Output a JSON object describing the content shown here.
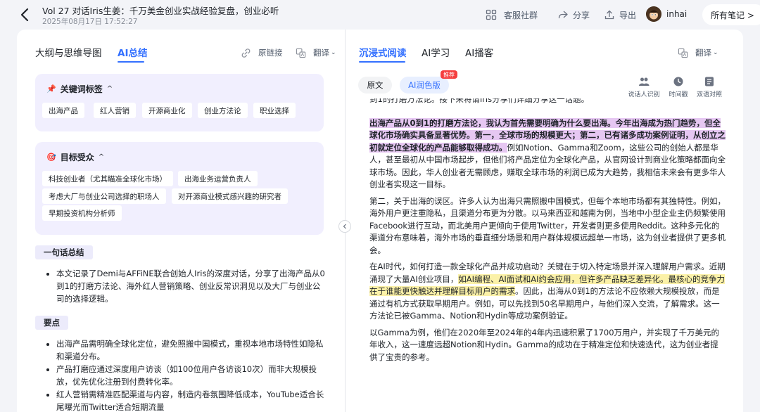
{
  "header": {
    "title": "Vol 27 对话Iris生姜：千万美金创业实战经验复盘，创业必听",
    "date": "2025年08月17日 17:52:27",
    "actions": {
      "service": "客服社群",
      "share": "分享",
      "export": "导出"
    },
    "user": "inhai",
    "all_notes": "所有笔记 >"
  },
  "left": {
    "tabs": [
      "大纲与思维导图",
      "AI总结"
    ],
    "actions": {
      "link": "原链接",
      "translate": "翻译"
    },
    "keywords": {
      "emoji": "📌",
      "title": "关键词标签",
      "chevron": "^",
      "items": [
        "出海产品",
        "红人营销",
        "开源商业化",
        "创业方法论",
        "职业选择"
      ]
    },
    "audience": {
      "emoji": "🎯",
      "title": "目标受众",
      "chevron": "^",
      "items": [
        "科技创业者（尤其瞄准全球化市场）",
        "出海业务运营负责人",
        "考虑大厂与创业公司选择的职场人",
        "对开源商业模式感兴趣的研究者",
        "早期投资机构分析师"
      ]
    },
    "one_line": {
      "label": "一句话总结",
      "text": "本文记录了Demi与AFFiNE联合创始人Iris的深度对话，分享了出海产品从0到1的打磨方法论、海外红人营销策略、创业反常识洞见以及大厂与创业公司的选择逻辑。"
    },
    "key_points": {
      "label": "要点",
      "items": [
        "出海产品需明确全球化定位，避免照搬中国模式，重视本地市场特性如隐私和渠道分布。",
        "产品打磨应通过深度用户访谈（如100位用户各访谈10次）而非大规模投放，优先优化注册到付费转化率。",
        "红人营销需精准匹配渠道与内容，制造内卷氛围降低成本，YouTube适合长尾曝光而Twitter适合短期流量"
      ]
    }
  },
  "right": {
    "tabs": [
      "沉浸式阅读",
      "AI学习",
      "AI播客"
    ],
    "translate": "翻译",
    "pill_original": "原文",
    "pill_ai": "AI润色版",
    "badge": "推荐",
    "tools": [
      "说话人识别",
      "时间戳",
      "双语对照"
    ],
    "article": {
      "first_line": "到1的打磨方法论。接下来将请Iris分享们详细分享这一话题。",
      "p1_hl": "出海产品从0到1的打磨方法论，我认为首先需要明确为什么要出海。今年出海成为热门趋势，但全球化市场确实具备显著优势。第一，全球市场的规模更大；第二，已有诸多成功案例证明，从创立之初就定位全球化的产品能够取得成功。",
      "p1_rest": "例如Notion、Gamma和Zoom，这些公司的创始人都是华人，甚至最初从中国市场起步，但他们将产品定位为全球化产品，从官网设计到商业化策略都面向全球市场。因此，华人创业者无需顾虑，赚取全球市场的利润已成为大趋势，我相信未来会有更多华人创业者实现这一目标。",
      "p2": "第二，关于出海的误区。许多人认为出海只需照搬中国模式，但每个本地市场都有其独特性。例如，海外用户更注重隐私，且渠道分布更为分散。以马来西亚和越南为例，当地中小型企业主仍频繁使用Facebook进行互动，而北美用户更倾向于使用Twitter，开发者则更多使用Reddit。这种多元化的渠道分布意味着，海外市场的垂直细分场景和用户群体规模远超单一市场，这为创业者提供了更多机会。",
      "p3_a": "在AI时代，如何打造一款全球化产品并成功启动？关键在于切入特定场景并深入理解用户需求。近期涌现了大量AI创业项目，",
      "p3_hl": "如AI编程、AI面试和AI约会应用，但许多产品缺乏差异化。最核心的竞争力在于谁能更快触达并理解目标用户的需求",
      "p3_b": "。因此，出海从0到1的方法论不应依赖大规模投放，而是通过有机方式获取早期用户。例如，可以先找到50名早期用户，与他们深入交流，了解需求。这一方法论已被Gamma、Notion和Hydin等成功案例验证。",
      "p4": "以Gamma为例，他们在2020年至2024年的4年内迅速积累了1700万用户，并实现了千万美元的年收入，这一速度远超Notion和Hydin。Gamma的成功在于精准定位和快速迭代，这为创业者提供了宝贵的参考。"
    }
  },
  "colors": {
    "accent": "#3370ff",
    "card_bg": "#f1effe",
    "highlight_purple": "#e6c7f2",
    "highlight_yellow": "#fbf1a8",
    "badge_red": "#f53f3f"
  }
}
